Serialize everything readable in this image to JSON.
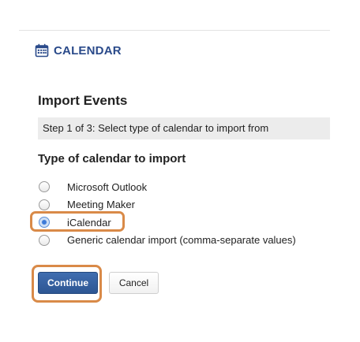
{
  "tool": {
    "title": "CALENDAR",
    "icon": "calendar-icon"
  },
  "page": {
    "title": "Import Events",
    "step": "Step 1 of 3: Select type of calendar to import from",
    "question": "Type of calendar to import"
  },
  "options": [
    {
      "label": "Microsoft Outlook",
      "selected": false
    },
    {
      "label": "Meeting Maker",
      "selected": false
    },
    {
      "label": "iCalendar",
      "selected": true
    },
    {
      "label": "Generic calendar import (comma-separate values)",
      "selected": false
    }
  ],
  "actions": {
    "continue_label": "Continue",
    "cancel_label": "Cancel"
  },
  "colors": {
    "accent": "#2a4a8a",
    "primary_button": "#2d5693",
    "highlight": "#d98a48"
  }
}
